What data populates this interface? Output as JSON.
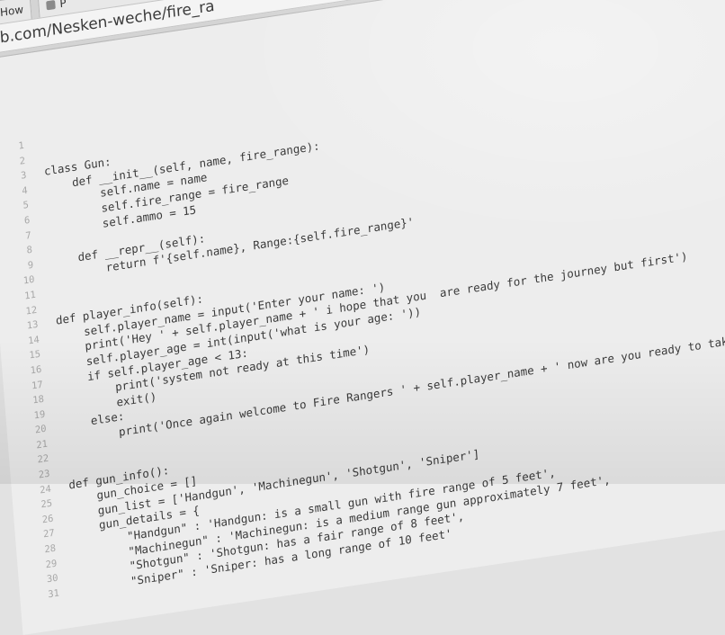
{
  "browser": {
    "tabs": [
      {
        "label": "How"
      },
      {
        "label": "P"
      }
    ],
    "address": "hub.com/Nesken-weche/fire_ra"
  },
  "editor": {
    "lines": [
      {
        "num": "1",
        "text": ""
      },
      {
        "num": "2",
        "text": ""
      },
      {
        "num": "3",
        "text": "class Gun:"
      },
      {
        "num": "4",
        "text": "    def __init__(self, name, fire_range):"
      },
      {
        "num": "5",
        "text": "        self.name = name"
      },
      {
        "num": "6",
        "text": "        self.fire_range = fire_range"
      },
      {
        "num": "7",
        "text": "        self.ammo = 15"
      },
      {
        "num": "8",
        "text": ""
      },
      {
        "num": "9",
        "text": "    def __repr__(self):"
      },
      {
        "num": "10",
        "text": "        return f'{self.name}, Range:{self.fire_range}'"
      },
      {
        "num": "11",
        "text": ""
      },
      {
        "num": "12",
        "text": ""
      },
      {
        "num": "13",
        "text": "def player_info(self):"
      },
      {
        "num": "14",
        "text": "    self.player_name = input('Enter your name: ')"
      },
      {
        "num": "15",
        "text": "    print('Hey ' + self.player_name + ' i hope that you  are ready for the journey but first')"
      },
      {
        "num": "16",
        "text": "    self.player_age = int(input('what is your age: '))"
      },
      {
        "num": "17",
        "text": "    if self.player_age < 13:"
      },
      {
        "num": "18",
        "text": "        print('system not ready at this time')"
      },
      {
        "num": "19",
        "text": "        exit()"
      },
      {
        "num": "20",
        "text": "    else:"
      },
      {
        "num": "21",
        "text": "        print('Once again welcome to Fire Rangers ' + self.player_name + ' now are you ready to take down the enemy?')"
      },
      {
        "num": "22",
        "text": ""
      },
      {
        "num": "23",
        "text": ""
      },
      {
        "num": "24",
        "text": "def gun_info():"
      },
      {
        "num": "25",
        "text": "    gun_choice = []"
      },
      {
        "num": "26",
        "text": "    gun_list = ['Handgun', 'Machinegun', 'Shotgun', 'Sniper']"
      },
      {
        "num": "27",
        "text": "    gun_details = {"
      },
      {
        "num": "28",
        "text": "        \"Handgun\" : 'Handgun: is a small gun with fire range of 5 feet',"
      },
      {
        "num": "29",
        "text": "        \"Machinegun\" : 'Machinegun: is a medium range gun approximately 7 feet',"
      },
      {
        "num": "30",
        "text": "        \"Shotgun\" : 'Shotgun: has a fair range of 8 feet',"
      },
      {
        "num": "31",
        "text": "        \"Sniper\" : 'Sniper: has a long range of 10 feet'"
      }
    ]
  }
}
